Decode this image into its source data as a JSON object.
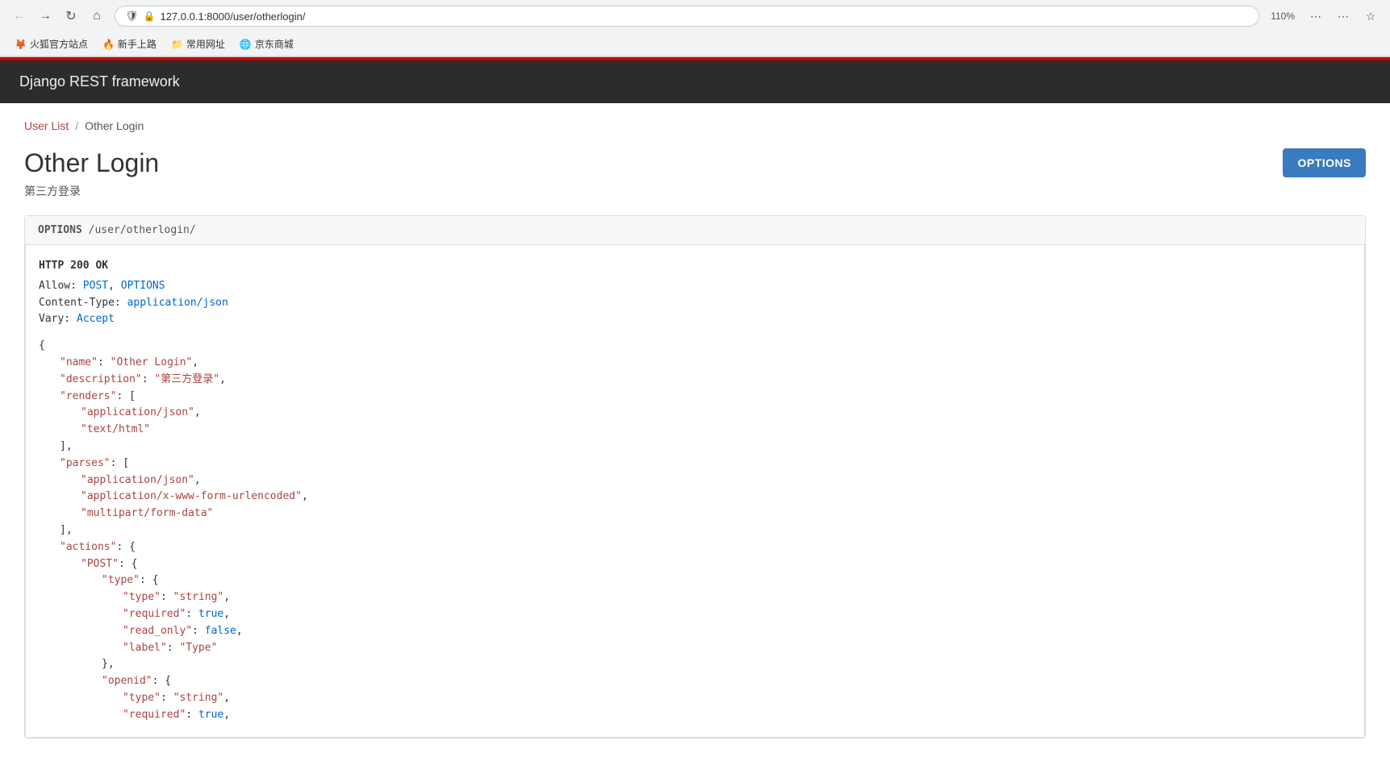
{
  "browser": {
    "url": "127.0.0.1:8000/user/otherlogin/",
    "zoom": "110%",
    "bookmarks": [
      {
        "label": "火狐官方站点",
        "icon": "🦊"
      },
      {
        "label": "新手上路",
        "icon": "🔥"
      },
      {
        "label": "常用网址",
        "icon": "📁"
      },
      {
        "label": "京东商城",
        "icon": "🌐"
      }
    ]
  },
  "app": {
    "framework_name": "Django REST framework"
  },
  "breadcrumb": {
    "user_list": "User List",
    "separator": "/",
    "current": "Other Login"
  },
  "page": {
    "title": "Other Login",
    "subtitle": "第三方登录",
    "options_button": "OPTIONS"
  },
  "request": {
    "method": "OPTIONS",
    "path": "/user/otherlogin/"
  },
  "response": {
    "status": "HTTP 200 OK",
    "allow_label": "Allow:",
    "allow_methods": [
      "POST",
      "OPTIONS"
    ],
    "content_type_label": "Content-Type:",
    "content_type_value": "application/json",
    "vary_label": "Vary:",
    "vary_value": "Accept"
  },
  "json_content": {
    "name_key": "\"name\"",
    "name_val": "\"Other Login\"",
    "description_key": "\"description\"",
    "description_val": "\"第三方登录\"",
    "renders_key": "\"renders\"",
    "render1": "\"application/json\"",
    "render2": "\"text/html\"",
    "parses_key": "\"parses\"",
    "parse1": "\"application/json\"",
    "parse2": "\"application/x-www-form-urlencoded\"",
    "parse3": "\"multipart/form-data\"",
    "actions_key": "\"actions\"",
    "post_key": "\"POST\"",
    "type_outer_key": "\"type\"",
    "type_type_key": "\"type\"",
    "type_type_val": "\"string\"",
    "type_required_key": "\"required\"",
    "type_required_val": "true",
    "type_readonly_key": "\"read_only\"",
    "type_readonly_val": "false",
    "type_label_key": "\"label\"",
    "type_label_val": "\"Type\"",
    "openid_key": "\"openid\"",
    "openid_type_key": "\"type\"",
    "openid_type_val": "\"string\"",
    "openid_required_key": "\"required\"",
    "openid_required_val": "true"
  }
}
